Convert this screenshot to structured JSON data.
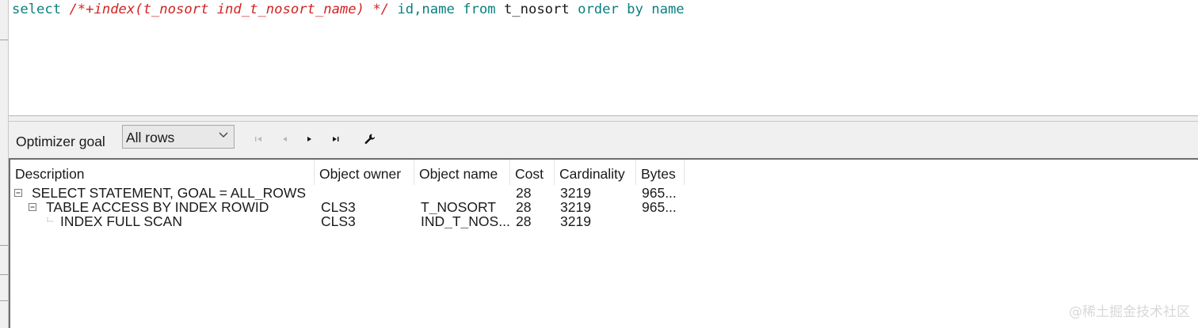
{
  "editor": {
    "sql": {
      "select": "select",
      "hint": "/*+index(t_nosort ind_t_nosort_name) */",
      "cols": "id,name",
      "from": "from",
      "table": "t_nosort",
      "order_by": "order by",
      "order_col": "name"
    }
  },
  "toolbar": {
    "optimizer_label": "Optimizer goal",
    "goal_value": "All rows",
    "icons": [
      "first-record-icon",
      "prior-record-icon",
      "next-record-icon",
      "last-record-icon",
      "wrench-icon"
    ]
  },
  "plan": {
    "columns": [
      "Description",
      "Object owner",
      "Object name",
      "Cost",
      "Cardinality",
      "Bytes"
    ],
    "rows": [
      {
        "description": "SELECT STATEMENT, GOAL = ALL_ROWS",
        "owner": "",
        "name": "",
        "cost": "28",
        "cardinality": "3219",
        "bytes": "965..."
      },
      {
        "description": "TABLE ACCESS BY INDEX ROWID",
        "owner": "CLS3",
        "name": "T_NOSORT",
        "cost": "28",
        "cardinality": "3219",
        "bytes": "965..."
      },
      {
        "description": "INDEX FULL SCAN",
        "owner": "CLS3",
        "name": "IND_T_NOS...",
        "cost": "28",
        "cardinality": "3219",
        "bytes": ""
      }
    ]
  },
  "watermark": "@稀土掘金技术社区"
}
